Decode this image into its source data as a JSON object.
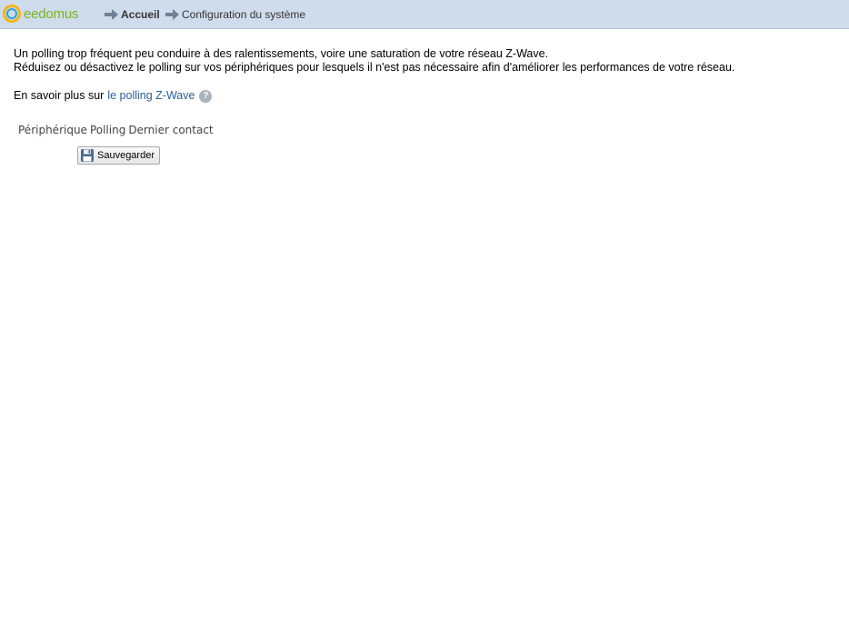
{
  "header": {
    "logo_text": "eedomus",
    "breadcrumb": [
      "Accueil",
      "Configuration du système"
    ]
  },
  "intro": {
    "line1": "Un polling trop fréquent peu conduire à des ralentissements, voire une saturation de votre réseau Z-Wave.",
    "line2": "Réduisez ou désactivez le polling sur vos périphériques pour lesquels il n'est pas nécessaire afin d'améliorer les performances de votre réseau."
  },
  "more": {
    "prefix": "En savoir plus sur",
    "link_text": "le polling Z-Wave",
    "help_glyph": "?"
  },
  "table": {
    "columns": [
      "Périphérique",
      "Polling",
      "Dernier contact"
    ]
  },
  "actions": {
    "save_label": "Sauvegarder"
  },
  "colors": {
    "header_bg": "#cfdcec",
    "link": "#2a5d9a",
    "logo_green": "#7bb51e",
    "logo_yellow": "#f3b41b",
    "logo_blue": "#2aa4d9"
  }
}
